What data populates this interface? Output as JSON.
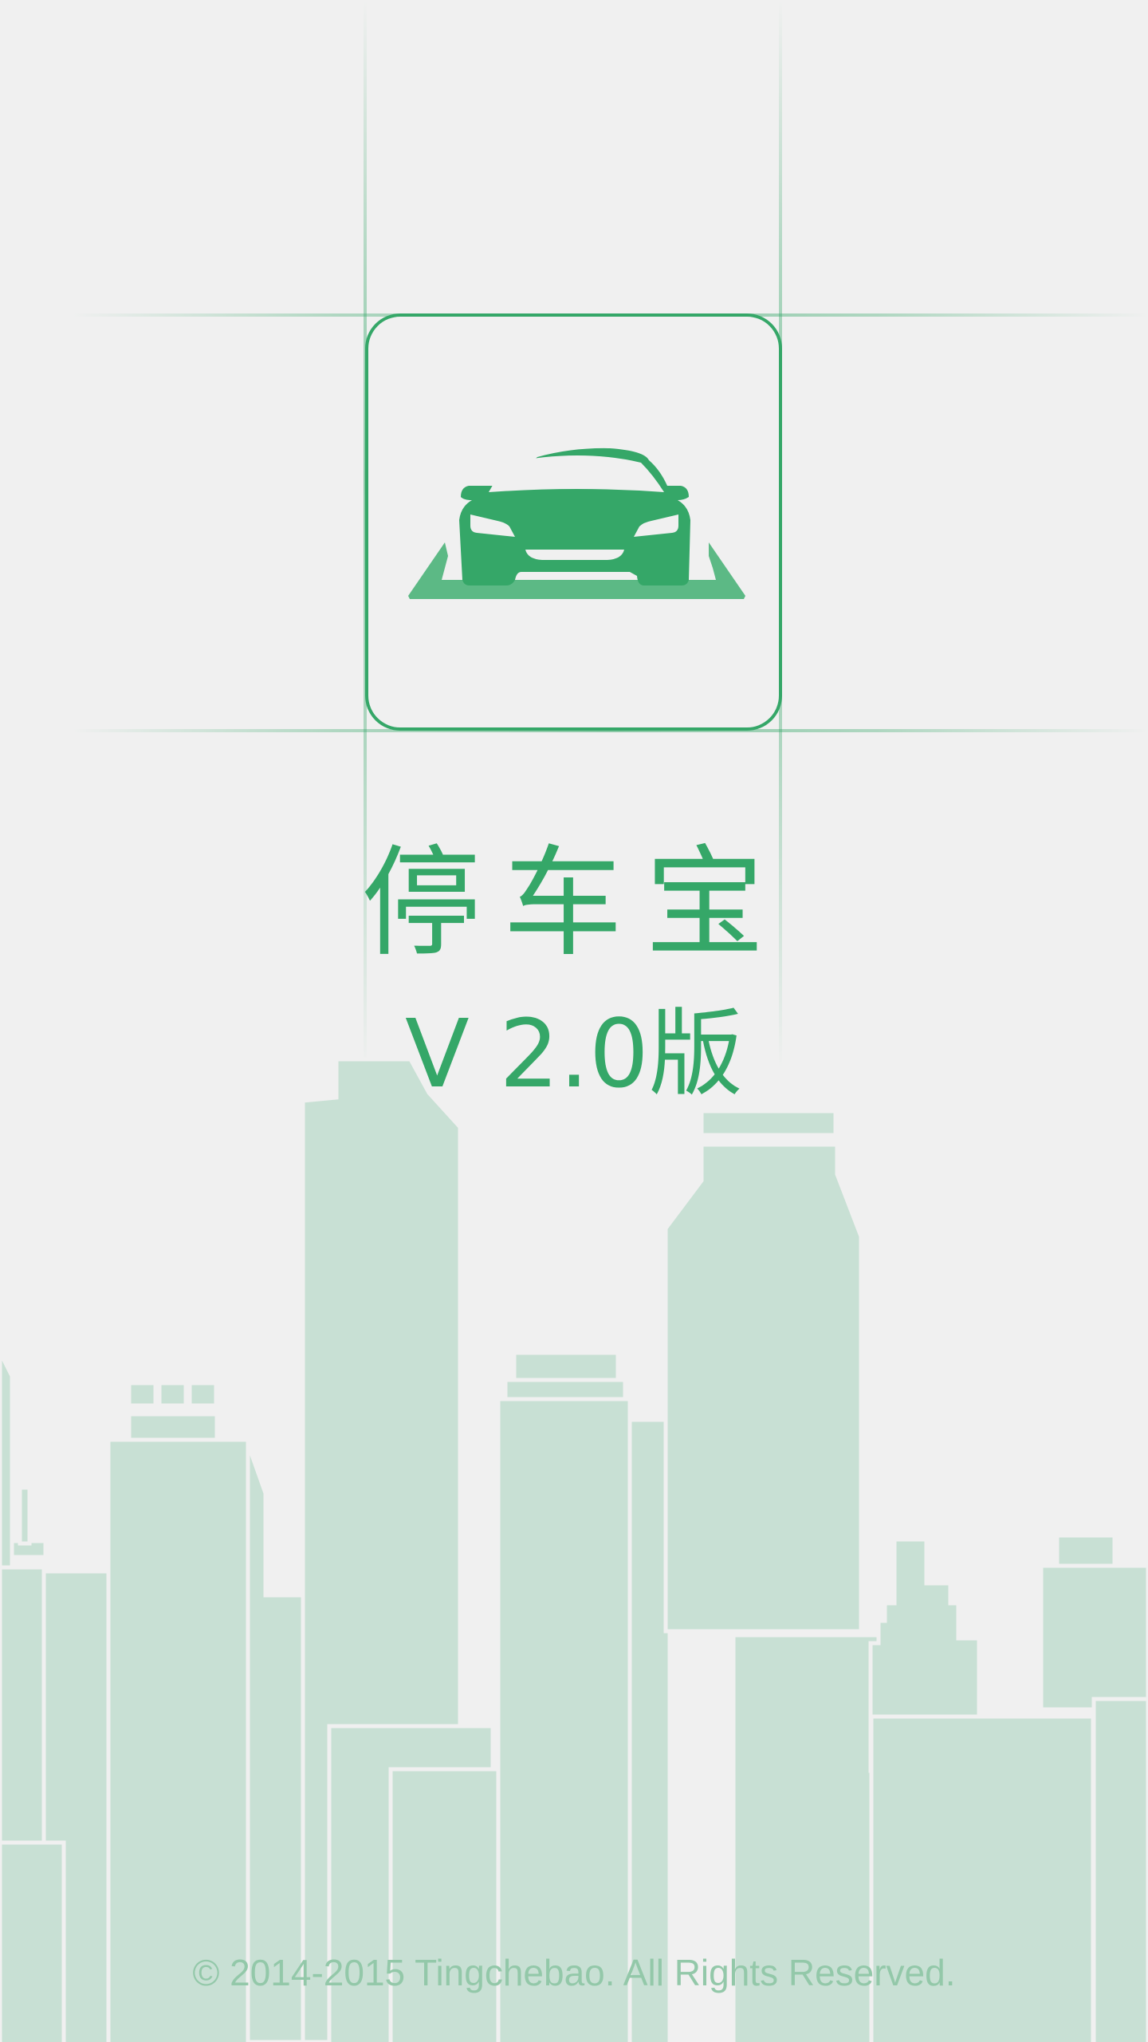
{
  "splash": {
    "app_name": "停车宝",
    "version_label": "V 2.0版",
    "copyright": "© 2014-2015 Tingchebao. All Rights Reserved.",
    "logo_icon": "car-parking-icon",
    "background_illustration": "city-skyline"
  },
  "colors": {
    "background": "#f0f0f0",
    "brand_green": "#35a768",
    "skyline": "#c8e0d4",
    "copyright_text": "#93c8a9"
  }
}
